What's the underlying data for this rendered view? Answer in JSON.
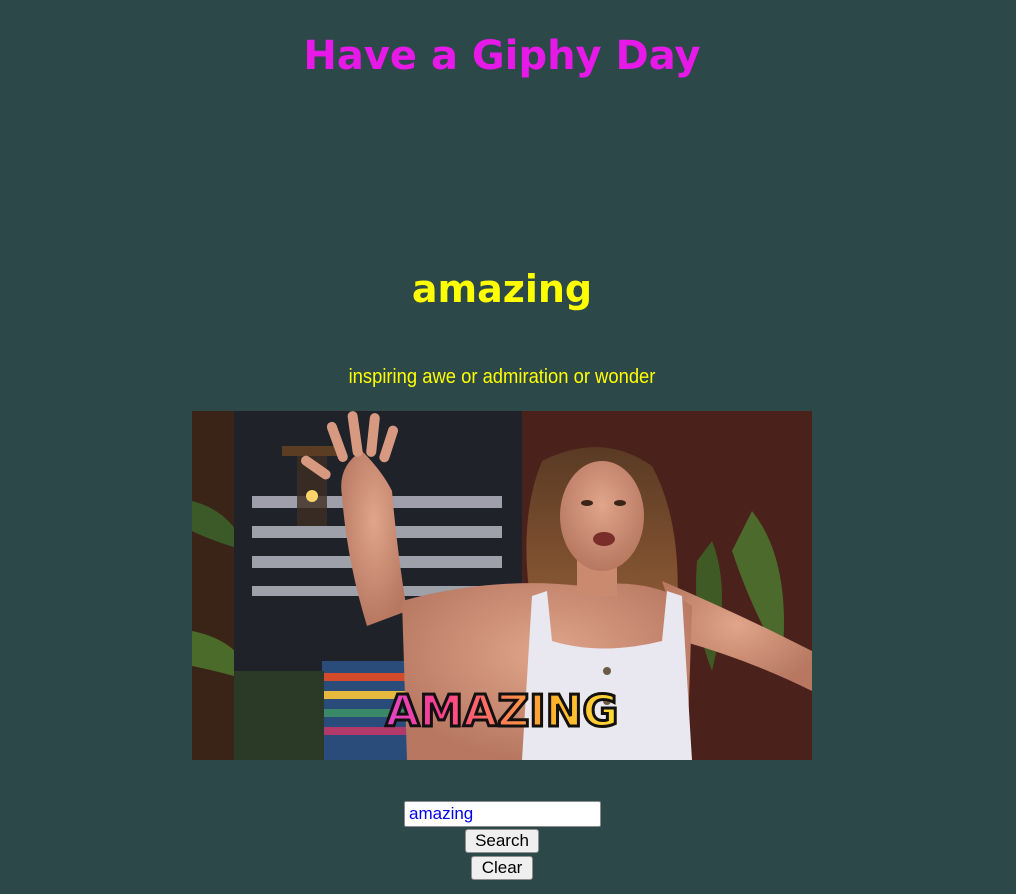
{
  "header": {
    "title": "Have a Giphy Day"
  },
  "result": {
    "word": "amazing",
    "definition": "inspiring awe or admiration or wonder",
    "gif_caption": "AMAZING"
  },
  "search": {
    "value": "amazing",
    "search_label": "Search",
    "clear_label": "Clear"
  },
  "colors": {
    "background": "#2c4848",
    "title": "#e719e8",
    "word": "#ffff00",
    "definition": "#ffff00"
  }
}
